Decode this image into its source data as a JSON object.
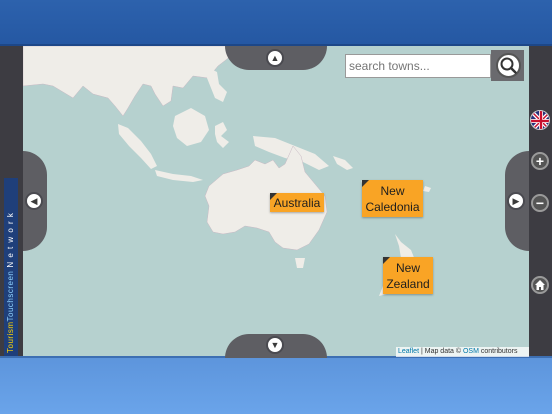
{
  "app": {
    "brand_part1": "Tourism",
    "brand_part2": "Touchscreen",
    "brand_part3": "Network"
  },
  "search": {
    "placeholder": "search towns...",
    "icon": "search-icon"
  },
  "nav": {
    "up_icon": "arrow-up-icon",
    "down_icon": "arrow-down-icon",
    "left_icon": "arrow-left-icon",
    "right_icon": "arrow-right-icon"
  },
  "controls": {
    "zoom_in": "+",
    "zoom_out": "−",
    "language_icon": "uk-flag-icon",
    "home_icon": "home-icon"
  },
  "labels": [
    {
      "name": "Australia"
    },
    {
      "name": "New\nCaledonia",
      "line1": "New",
      "line2": "Caledonia"
    },
    {
      "name": "New\nZealand",
      "line1": "New",
      "line2": "Zealand"
    }
  ],
  "attribution": {
    "leaflet": "Leaflet",
    "separator": " | Map data © ",
    "osm": "OSM",
    "suffix": " contributors"
  },
  "colors": {
    "top_bar": "#2558a3",
    "bottom_bar": "#6aa4ea",
    "frame": "#3d3c42",
    "label_bg": "#f9a425",
    "water": "#b6d1cf",
    "land": "#efede8"
  }
}
